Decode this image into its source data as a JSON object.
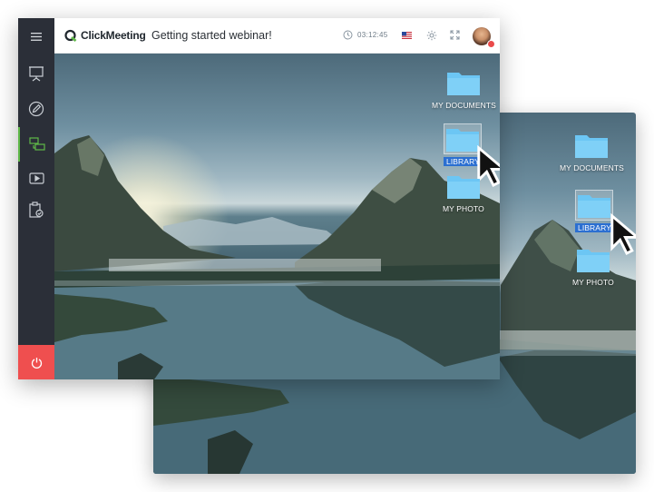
{
  "app": {
    "logo_text": "ClickMeeting",
    "title": "Getting started webinar!",
    "timer": "03:12:45"
  },
  "colors": {
    "sidebar_bg": "#2b2f38",
    "accent_green": "#5fb848",
    "power_red": "#ef4f4f",
    "selection_blue": "#2b6fd1"
  },
  "sidebar": {
    "items": [
      {
        "icon": "menu-icon"
      },
      {
        "icon": "presentation-icon"
      },
      {
        "icon": "whiteboard-icon"
      },
      {
        "icon": "screen-share-icon",
        "active": true
      },
      {
        "icon": "video-icon"
      },
      {
        "icon": "test-icon"
      }
    ],
    "power_icon": "power-icon"
  },
  "topbar_icons": [
    "clock-icon",
    "flag-us-icon",
    "gear-icon",
    "fullscreen-icon",
    "avatar"
  ],
  "desktop_front": {
    "folders": [
      {
        "label": "MY DOCUMENTS"
      },
      {
        "label": "LIBRARY",
        "selected": true
      },
      {
        "label": "MY PHOTO"
      }
    ]
  },
  "desktop_back": {
    "folders": [
      {
        "label": "MY DOCUMENTS"
      },
      {
        "label": "LIBRARY",
        "selected": true
      },
      {
        "label": "MY PHOTO"
      }
    ]
  }
}
